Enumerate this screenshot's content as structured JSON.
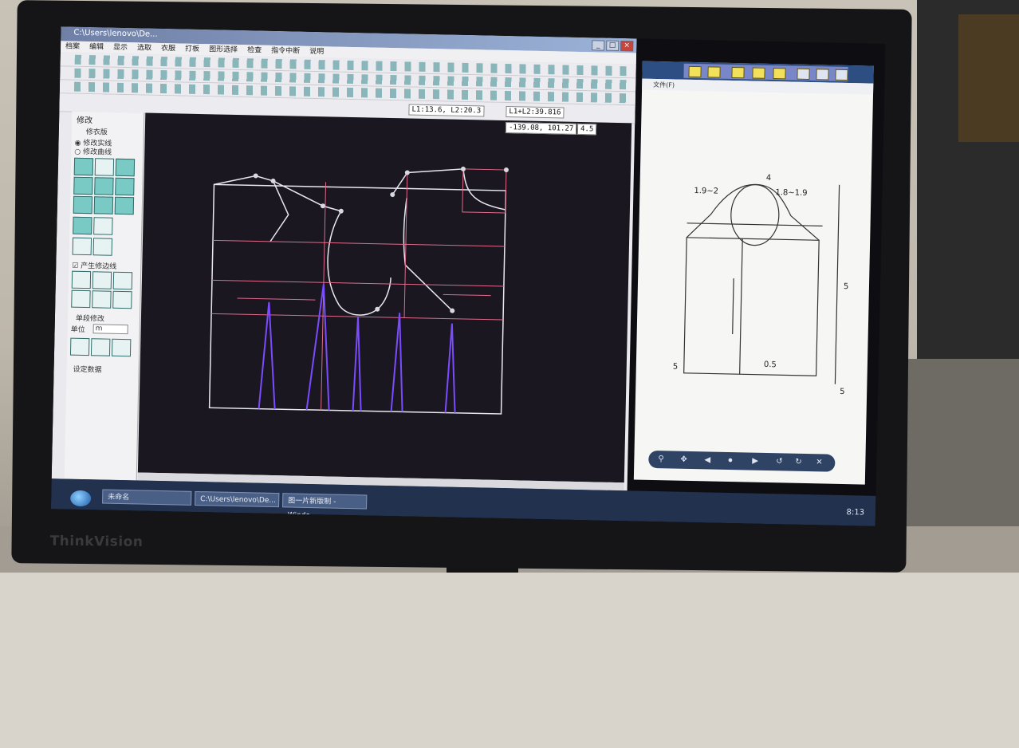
{
  "cad_window": {
    "title": "C:\\Users\\lenovo\\De...",
    "menu": [
      "档案",
      "编辑",
      "显示",
      "选取",
      "衣服",
      "打板",
      "图形选择",
      "检查",
      "指令中断",
      "说明"
    ],
    "measure_1": "L1:13.6, L2:20.3",
    "measure_2": "L1+L2:39.816",
    "coords": "-139.08, 101.27",
    "zoom": "4.5",
    "panel_title": "修改",
    "panel_subtitle": "修衣版",
    "radio_1": "修改实线",
    "radio_2": "修改曲线",
    "checkbox_label": "产生修边线",
    "section_label": "单段修改",
    "unit_label": "单位",
    "unit_value": "m",
    "bottom_label": "设定数据"
  },
  "viewer_window": {
    "menu_file": "文件(F)",
    "labels": [
      "1.9~2",
      "1.8~1.9",
      "4",
      "5",
      "0.5",
      "5",
      "5"
    ],
    "controls": [
      "zoom",
      "prev",
      "slideshow",
      "next",
      "rotate-left",
      "rotate-right",
      "delete"
    ]
  },
  "taskbar": {
    "buttons": [
      "未命名",
      "C:\\Users\\lenovo\\De...",
      "图一片新版制 - Windo..."
    ],
    "clock": "8:13"
  },
  "monitor_brand": "ThinkVision",
  "colors": {
    "canvas": "#1b1721",
    "pattern_line": "#e8e8f0",
    "guide_pink": "#e06a8a",
    "dart_purple": "#7a4bff",
    "title_blue": "#2d4e83"
  }
}
